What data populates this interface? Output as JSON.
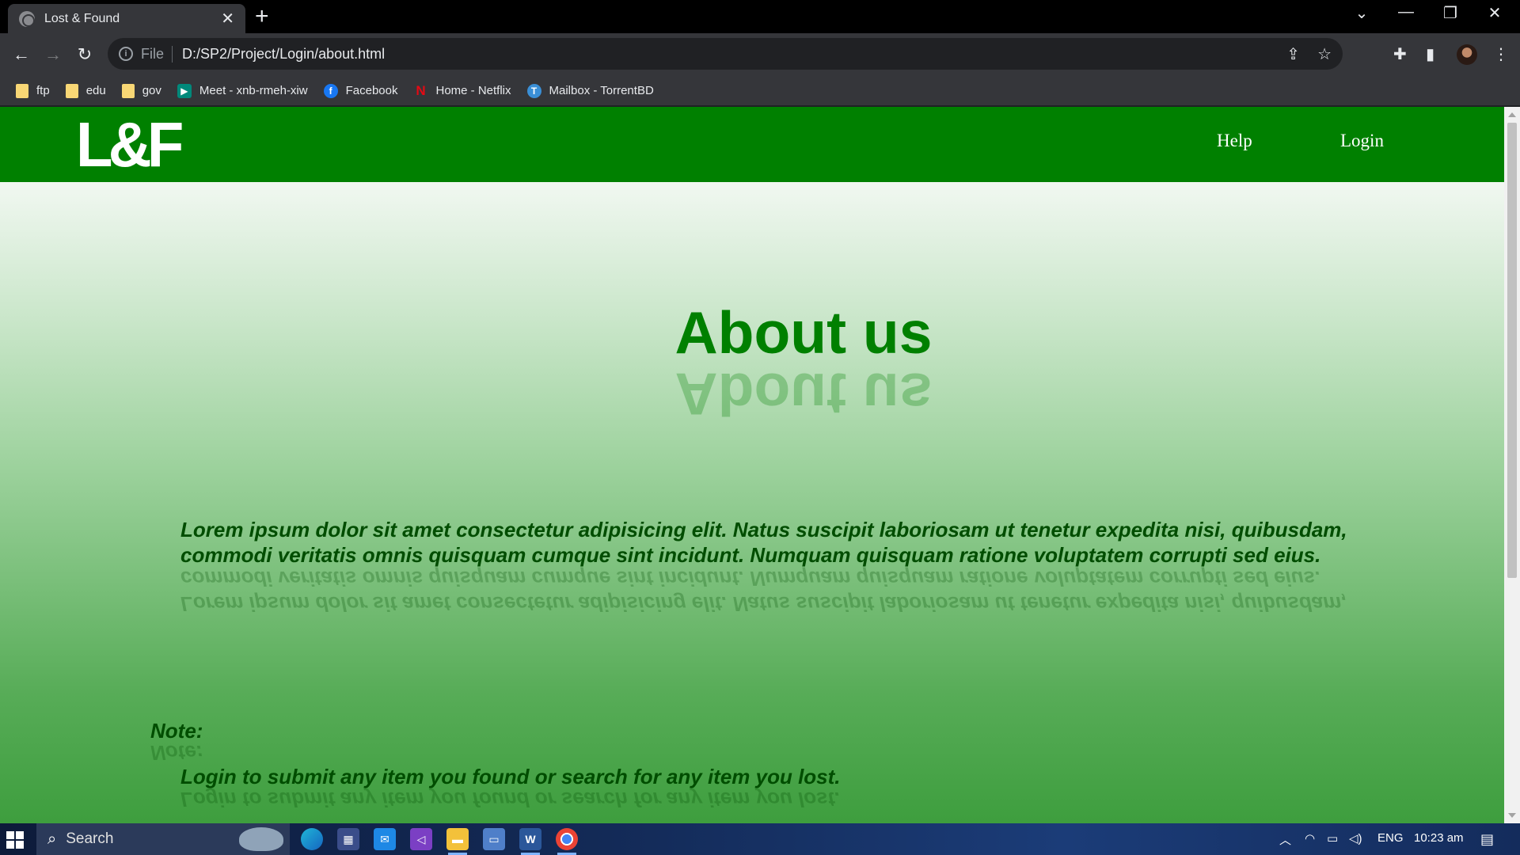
{
  "browser": {
    "tab_title": "Lost & Found",
    "tab_close": "✕",
    "new_tab": "+",
    "address_scheme": "File",
    "address_url": "D:/SP2/Project/Login/about.html",
    "bookmarks": [
      "ftp",
      "edu",
      "gov",
      "Meet - xnb-rmeh-xiw",
      "Facebook",
      "Home - Netflix",
      "Mailbox - TorrentBD"
    ]
  },
  "site": {
    "logo": "L&F",
    "nav": {
      "help": "Help",
      "login": "Login"
    },
    "title": "About us",
    "paragraph_line1": "Lorem ipsum dolor sit amet consectetur adipisicing elit. Natus suscipit laboriosam ut tenetur expedita nisi, quibusdam,",
    "paragraph_line2": "commodi veritatis omnis quisquam cumque sint incidunt. Numquam quisquam ratione voluptatem corrupti sed eius.",
    "note_label": "Note:",
    "note_text": "Login to submit any item you found or search for any item you lost."
  },
  "taskbar": {
    "search_placeholder": "Search",
    "language": "ENG",
    "time": "10:23 am"
  },
  "colors": {
    "nav_green": "#008000",
    "title_green": "#008000",
    "text_dark_green": "#004d00"
  }
}
